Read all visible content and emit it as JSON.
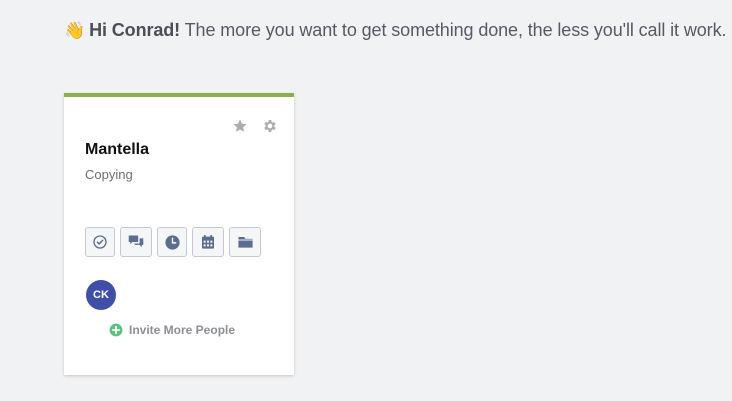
{
  "greeting": {
    "emoji": "👋",
    "hi": "Hi Conrad!",
    "message": "The more you want to get something done, the less you'll call it work."
  },
  "project": {
    "title": "Mantella",
    "subtitle": "Copying",
    "accent_color": "#8bb04a",
    "actions": [
      "star-icon",
      "gear-icon"
    ],
    "tools": [
      "todos-icon",
      "messages-icon",
      "time-icon",
      "calendar-icon",
      "files-icon"
    ],
    "members": [
      {
        "initials": "CK",
        "color": "#3f4fa8"
      }
    ],
    "invite_label": "Invite More People"
  }
}
